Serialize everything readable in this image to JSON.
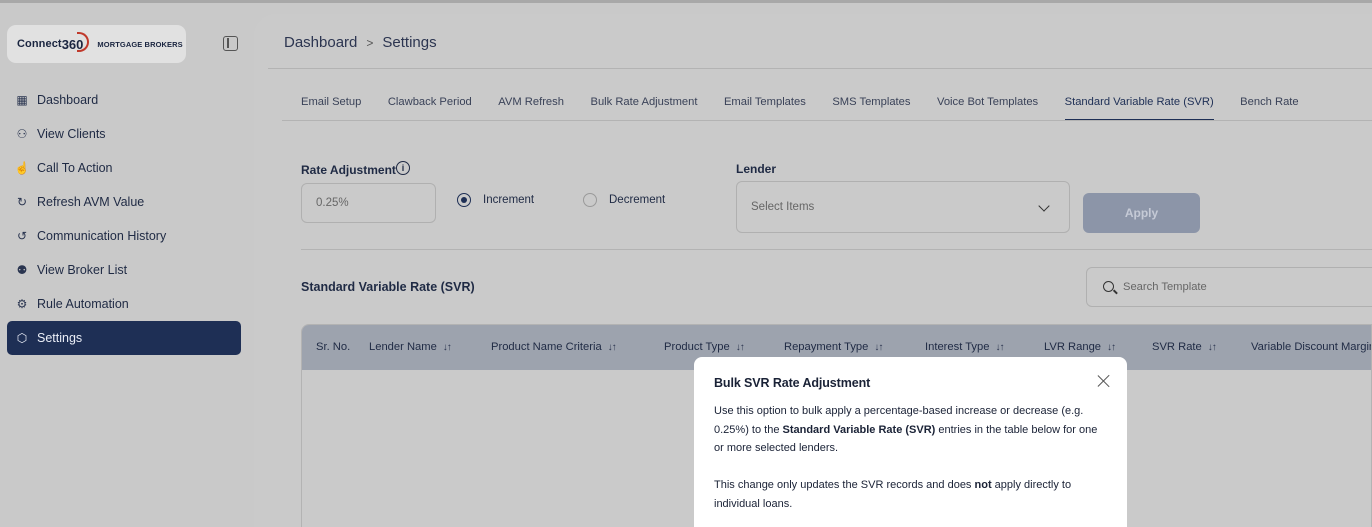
{
  "brand": {
    "name": "Connect",
    "number": "360",
    "tagline": "MORTGAGE BROKERS"
  },
  "sidebar": {
    "items": [
      {
        "label": "Dashboard",
        "icon": "dashboard-grid-icon"
      },
      {
        "label": "View Clients",
        "icon": "users-icon"
      },
      {
        "label": "Call To Action",
        "icon": "hand-pointer-icon"
      },
      {
        "label": "Refresh AVM Value",
        "icon": "refresh-icon"
      },
      {
        "label": "Communication History",
        "icon": "history-icon"
      },
      {
        "label": "View Broker List",
        "icon": "broker-group-icon"
      },
      {
        "label": "Rule Automation",
        "icon": "automation-gear-icon"
      },
      {
        "label": "Settings",
        "icon": "settings-icon",
        "active": true
      }
    ]
  },
  "breadcrumb": {
    "root": "Dashboard",
    "current": "Settings"
  },
  "tabs": [
    {
      "label": "Email Setup"
    },
    {
      "label": "Clawback Period"
    },
    {
      "label": "AVM Refresh"
    },
    {
      "label": "Bulk Rate Adjustment"
    },
    {
      "label": "Email Templates"
    },
    {
      "label": "SMS Templates"
    },
    {
      "label": "Voice Bot Templates"
    },
    {
      "label": "Standard Variable Rate (SVR)",
      "active": true
    },
    {
      "label": "Bench Rate"
    }
  ],
  "form": {
    "rate_label": "Rate Adjustment",
    "rate_placeholder": "0.25%",
    "increment_label": "Increment",
    "decrement_label": "Decrement",
    "selected_mode": "Increment",
    "lender_label": "Lender",
    "lender_placeholder": "Select Items",
    "apply_label": "Apply"
  },
  "section": {
    "title": "Standard Variable Rate (SVR)",
    "search_placeholder": "Search Template"
  },
  "table": {
    "columns": [
      {
        "label": "Sr. No.",
        "sortable": false
      },
      {
        "label": "Lender Name",
        "sortable": true
      },
      {
        "label": "Product Name Criteria",
        "sortable": true
      },
      {
        "label": "Product Type",
        "sortable": true
      },
      {
        "label": "Repayment Type",
        "sortable": true
      },
      {
        "label": "Interest Type",
        "sortable": true
      },
      {
        "label": "LVR Range",
        "sortable": true
      },
      {
        "label": "SVR Rate",
        "sortable": true
      },
      {
        "label": "Variable Discount Margin",
        "sortable": false
      }
    ]
  },
  "modal": {
    "title": "Bulk SVR Rate Adjustment",
    "p1_a": "Use this option to bulk apply a percentage-based increase or decrease (e.g. 0.25%) to the ",
    "p1_bold": "Standard Variable Rate (SVR)",
    "p1_b": " entries in the table below for one or more selected lenders.",
    "p2_a": "This change only updates the SVR records and does ",
    "p2_bold": "not",
    "p2_b": " apply directly to individual loans."
  },
  "colors": {
    "primary": "#1e2f55",
    "overlay_bg": "#c9c9c9",
    "modal_bg": "#ffffff",
    "disabled_button": "#8c95a8"
  }
}
